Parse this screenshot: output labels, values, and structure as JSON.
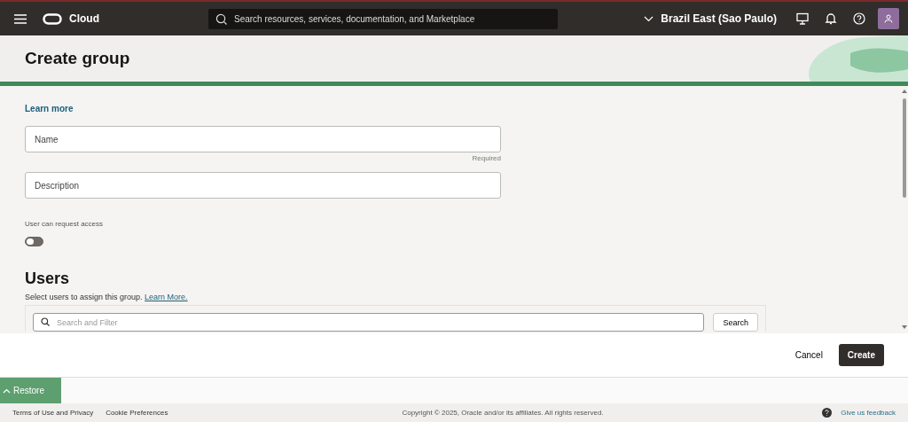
{
  "header": {
    "brand": "Cloud",
    "search": {
      "placeholder": "Search resources, services, documentation, and Marketplace"
    },
    "region": "Brazil East (Sao Paulo)"
  },
  "page_title": "Create group",
  "form": {
    "learn_more": "Learn more",
    "fields": [
      {
        "placeholder": "Name",
        "hint": "Required"
      },
      {
        "placeholder": "Description"
      }
    ],
    "toggle": {
      "label": "User can request access",
      "on": false
    }
  },
  "users": {
    "heading": "Users",
    "text": "Select users to assign this group.",
    "link": "Learn More.",
    "search": {
      "placeholder": "Search and Filter"
    },
    "search_button": "Search"
  },
  "actions": {
    "cancel": "Cancel",
    "create": "Create"
  },
  "restore": "Restore",
  "footer": {
    "links": [
      "Terms of Use and Privacy",
      "Cookie Preferences"
    ],
    "copyright": "Copyright © 2025, Oracle and/or its affiliates. All rights reserved.",
    "feedback": "Give us feedback"
  }
}
